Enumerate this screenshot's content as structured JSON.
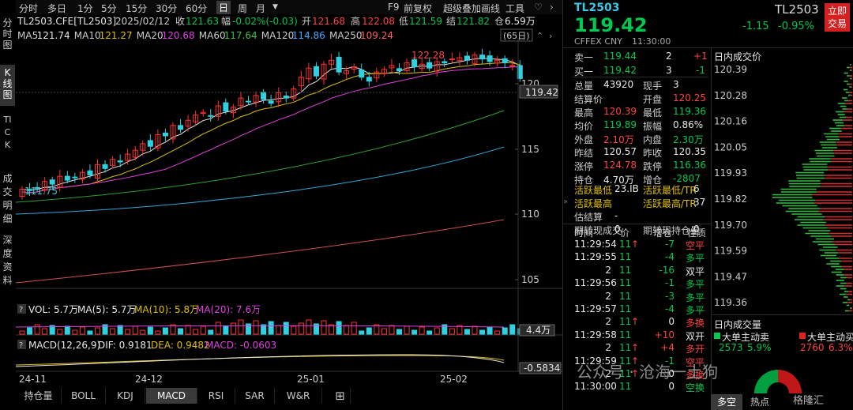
{
  "toolbar": {
    "items": [
      "分时",
      "多日",
      "1分",
      "5分",
      "15分",
      "30分",
      "60分",
      "日",
      "周",
      "月"
    ],
    "active": "日",
    "dropdown_icon": "chevron-down-icon",
    "right_items": [
      "F9",
      "前复权",
      "超级叠加",
      "画线",
      "工具"
    ],
    "fav_icon": "heart-icon",
    "menu_icon": "chevron-right-icon"
  },
  "sidebar": [
    "分时图",
    "K线图",
    "TICK",
    "成交明细",
    "深度资料"
  ],
  "info_row": {
    "title": "TL2503.CFE[TL2503]",
    "date": "2025/02/12",
    "close_label": "收",
    "close_val": "121.63",
    "range_label": "幅",
    "range_val": "-0.02%(-0.03)",
    "open_label": "开",
    "open_val": "121.68",
    "high_label": "高",
    "high_val": "122.08",
    "low_label": "低",
    "low_val": "121.59",
    "settle_label": "结",
    "settle_val": "121.82",
    "oi_label": "仓",
    "oi_val": "6.59万"
  },
  "ma_row": [
    {
      "label": "MA5",
      "val": "121.74",
      "color": "#e8e8e8"
    },
    {
      "label": "MA10",
      "val": "121.27",
      "color": "#e0c000"
    },
    {
      "label": "MA20",
      "val": "120.68",
      "color": "#e040e0"
    },
    {
      "label": "MA60",
      "val": "117.64",
      "color": "#40c040"
    },
    {
      "label": "MA120",
      "val": "114.86",
      "color": "#40a8ff"
    },
    {
      "label": "MA250",
      "val": "109.24",
      "color": "#ff6060"
    }
  ],
  "period_label": "(65日)",
  "price_axis": {
    "ticks": [
      "120",
      "115",
      "110",
      "105"
    ],
    "current": "119.42"
  },
  "annotations": {
    "high": "122.28",
    "low": "111.75"
  },
  "vol_row": {
    "q": "?",
    "vol": "VOL: 5.7万",
    "ma5": "MA(5): 5.7万",
    "ma10": "MA(10): 5.8万",
    "ma20": "MA(20): 7.6万",
    "axis": "4.4万"
  },
  "macd_row": {
    "q": "?",
    "label": "MACD(12,26,9)",
    "dif": "DIF: 0.9181",
    "dea": "DEA: 0.9482",
    "macd": "MACD: -0.0603",
    "axis": "-0.5834"
  },
  "x_axis": [
    "24-11",
    "24-12",
    "25-01",
    "25-02"
  ],
  "bottom_tabs": [
    "持仓量",
    "BOLL",
    "KDJ",
    "MACD",
    "RSI",
    "SAR",
    "W&R"
  ],
  "bottom_active": "MACD",
  "add_icon": "plus-box-icon",
  "right": {
    "code": "TL2503",
    "code_right": "TL2503",
    "price": "119.42",
    "exchange": "CFFEX  CNY",
    "time": "11:30:00",
    "change": "-1.15",
    "change_pct": "-0.95%",
    "trade_btn": "立即交易",
    "ask": {
      "label": "卖一",
      "price": "119.44",
      "vol": "2",
      "chg": "+1"
    },
    "bid": {
      "label": "买一",
      "price": "119.42",
      "vol": "3",
      "chg": "-1"
    },
    "stats": [
      [
        "总量",
        "43920",
        "现手",
        "3"
      ],
      [
        "结算价",
        "",
        "开盘",
        "120.25"
      ],
      [
        "最高",
        "120.39",
        "最低",
        "119.36"
      ],
      [
        "均价",
        "119.89",
        "振幅",
        "0.86%"
      ],
      [
        "外盘",
        "2.10万",
        "内盘",
        "2.30万"
      ],
      [
        "昨结",
        "120.57",
        "昨收",
        "120.35"
      ],
      [
        "涨停",
        "124.78",
        "跌停",
        "116.36"
      ],
      [
        "持仓",
        "4.70万",
        "增仓",
        "-2807"
      ]
    ],
    "extra": [
      [
        "活跃最低",
        "23.IB",
        "活跃最低/TR",
        "6"
      ],
      [
        "活跃最高",
        "",
        "活跃最高/TR",
        "37"
      ],
      [
        "估结算",
        "-",
        "",
        ""
      ],
      [
        "期转现成交",
        "0",
        "期转现持仓量",
        "0"
      ]
    ],
    "tick_header": [
      "时间",
      "价",
      "增仓",
      "性质"
    ],
    "ticks": [
      {
        "t": "11:29:54",
        "p": "11",
        "dir": "up",
        "chg": "-7",
        "nat": "空平",
        "c": "red"
      },
      {
        "t": "11:29:55",
        "p": "11",
        "dir": "",
        "chg": "-4",
        "nat": "多平",
        "c": "grn"
      },
      {
        "t": "2",
        "p": "11",
        "dir": "",
        "chg": "-16",
        "nat": "双平",
        "c": "wht"
      },
      {
        "t": "11:29:56",
        "p": "11",
        "dir": "",
        "chg": "-1",
        "nat": "多平",
        "c": "grn"
      },
      {
        "t": "2",
        "p": "11",
        "dir": "",
        "chg": "-3",
        "nat": "多平",
        "c": "grn"
      },
      {
        "t": "11:29:57",
        "p": "11",
        "dir": "",
        "chg": "-4",
        "nat": "多平",
        "c": "grn"
      },
      {
        "t": "2",
        "p": "11",
        "dir": "up",
        "chg": "0",
        "nat": "多换",
        "c": "red"
      },
      {
        "t": "11:29:58",
        "p": "11",
        "dir": "",
        "chg": "+10",
        "nat": "双开",
        "c": "wht"
      },
      {
        "t": "2",
        "p": "11",
        "dir": "up",
        "chg": "+4",
        "nat": "多开",
        "c": "red"
      },
      {
        "t": "11:29:59",
        "p": "11",
        "dir": "up",
        "chg": "-1",
        "nat": "空平",
        "c": "red"
      },
      {
        "t": "2",
        "p": "11",
        "dir": "up",
        "chg": "0",
        "nat": "多换",
        "c": "red"
      },
      {
        "t": "11:30:00",
        "p": "11",
        "dir": "",
        "chg": "0",
        "nat": "空换",
        "c": "grn"
      }
    ],
    "intraday_title": "日内成交价",
    "intraday_prices": [
      "120.39",
      "120.28",
      "120.16",
      "120.05",
      "119.93",
      "119.82",
      "119.70",
      "119.59",
      "119.47",
      "119.36"
    ],
    "volume_title": "日内成交量",
    "big_sell": {
      "label": "大单主动卖",
      "val": "2573",
      "pct": "5.9%"
    },
    "big_buy": {
      "label": "大单主动买",
      "val": "2760",
      "pct": "6.3%"
    },
    "bottom_tabs": [
      "多空",
      "热点"
    ],
    "watermark": "公众号 · 沧海一土狗",
    "brand": "格隆汇"
  }
}
